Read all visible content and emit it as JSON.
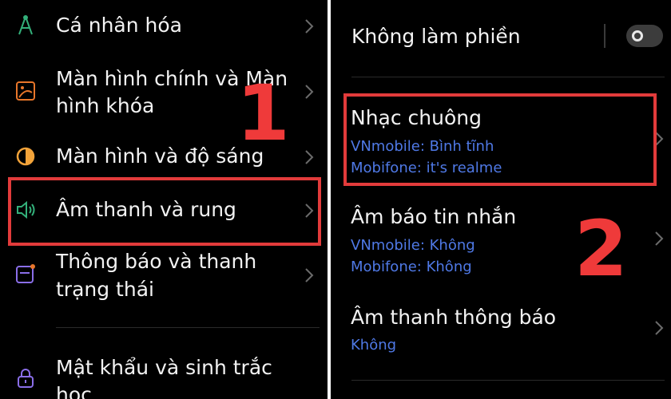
{
  "left_menu": {
    "items": [
      {
        "label": "Cá nhân hóa",
        "icon": "personalization-icon"
      },
      {
        "label_line1": "Màn hình chính và Màn",
        "label_line2": "hình khóa",
        "icon": "wallpaper-icon"
      },
      {
        "label": "Màn hình và độ sáng",
        "icon": "brightness-icon"
      },
      {
        "label": "Âm thanh và rung",
        "icon": "speaker-icon"
      },
      {
        "label_line1": "Thông báo và thanh",
        "label_line2": "trạng thái",
        "icon": "notification-icon"
      },
      {
        "label_line1": "Mật khẩu và sinh trắc",
        "label_line2": "học",
        "icon": "lock-icon"
      }
    ],
    "step_number": "1"
  },
  "sound_settings": {
    "do_not_disturb": {
      "label": "Không làm phiền",
      "enabled": false
    },
    "ringtone": {
      "label": "Nhạc chuông",
      "sim1": "VNmobile: Bình tĩnh",
      "sim2": "Mobifone: it's realme"
    },
    "message_tone": {
      "label": "Âm báo tin nhắn",
      "sim1": "VNmobile: Không",
      "sim2": "Mobifone: Không"
    },
    "notification_sound": {
      "label": "Âm thanh thông báo",
      "value": "Không"
    },
    "step_number": "2"
  },
  "colors": {
    "background": "#000000",
    "text": "#f2f2f2",
    "subtext_blue": "#4f79e6",
    "highlight_red": "#e23b3b"
  }
}
